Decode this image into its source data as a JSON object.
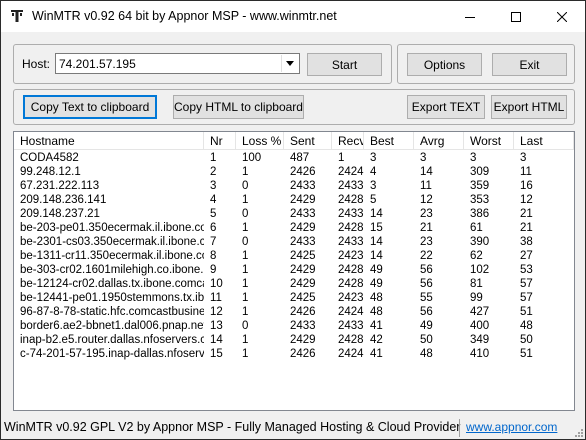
{
  "window": {
    "title": "WinMTR v0.92 64 bit by Appnor MSP - www.winmtr.net"
  },
  "host": {
    "label": "Host:",
    "value": "74.201.57.195"
  },
  "buttons": {
    "start": "Start",
    "options": "Options",
    "exit": "Exit",
    "copy_text": "Copy Text to clipboard",
    "copy_html": "Copy HTML to clipboard",
    "export_text": "Export TEXT",
    "export_html": "Export HTML"
  },
  "table": {
    "columns": [
      "Hostname",
      "Nr",
      "Loss %",
      "Sent",
      "Recv",
      "Best",
      "Avrg",
      "Worst",
      "Last"
    ],
    "rows": [
      [
        "CODA4582",
        "1",
        "100",
        "487",
        "1",
        "3",
        "3",
        "3",
        "3"
      ],
      [
        "99.248.12.1",
        "2",
        "1",
        "2426",
        "2424",
        "4",
        "14",
        "309",
        "11"
      ],
      [
        "67.231.222.113",
        "3",
        "0",
        "2433",
        "2433",
        "3",
        "11",
        "359",
        "16"
      ],
      [
        "209.148.236.141",
        "4",
        "1",
        "2429",
        "2428",
        "5",
        "12",
        "353",
        "12"
      ],
      [
        "209.148.237.21",
        "5",
        "0",
        "2433",
        "2433",
        "14",
        "23",
        "386",
        "21"
      ],
      [
        "be-203-pe01.350ecermak.il.ibone.co...",
        "6",
        "1",
        "2429",
        "2428",
        "15",
        "21",
        "61",
        "21"
      ],
      [
        "be-2301-cs03.350ecermak.il.ibone.c...",
        "7",
        "0",
        "2433",
        "2433",
        "14",
        "23",
        "390",
        "38"
      ],
      [
        "be-1311-cr11.350ecermak.il.ibone.co...",
        "8",
        "1",
        "2425",
        "2423",
        "14",
        "22",
        "62",
        "27"
      ],
      [
        "be-303-cr02.1601milehigh.co.ibone.c...",
        "9",
        "1",
        "2429",
        "2428",
        "49",
        "56",
        "102",
        "53"
      ],
      [
        "be-12124-cr02.dallas.tx.ibone.comca...",
        "10",
        "1",
        "2429",
        "2428",
        "49",
        "56",
        "81",
        "57"
      ],
      [
        "be-12441-pe01.1950stemmons.tx.ibo...",
        "11",
        "1",
        "2425",
        "2423",
        "48",
        "55",
        "99",
        "57"
      ],
      [
        "96-87-8-78-static.hfc.comcastbusine...",
        "12",
        "1",
        "2426",
        "2424",
        "48",
        "56",
        "427",
        "51"
      ],
      [
        "border6.ae2-bbnet1.dal006.pnap.net",
        "13",
        "0",
        "2433",
        "2433",
        "41",
        "49",
        "400",
        "48"
      ],
      [
        "inap-b2.e5.router.dallas.nfoservers.c...",
        "14",
        "1",
        "2429",
        "2428",
        "42",
        "50",
        "349",
        "50"
      ],
      [
        "c-74-201-57-195.inap-dallas.nfoserve...",
        "15",
        "1",
        "2426",
        "2424",
        "41",
        "48",
        "410",
        "51"
      ]
    ]
  },
  "status": {
    "text": "WinMTR v0.92 GPL V2 by Appnor MSP - Fully Managed Hosting & Cloud Provider",
    "link": "www.appnor.com"
  }
}
